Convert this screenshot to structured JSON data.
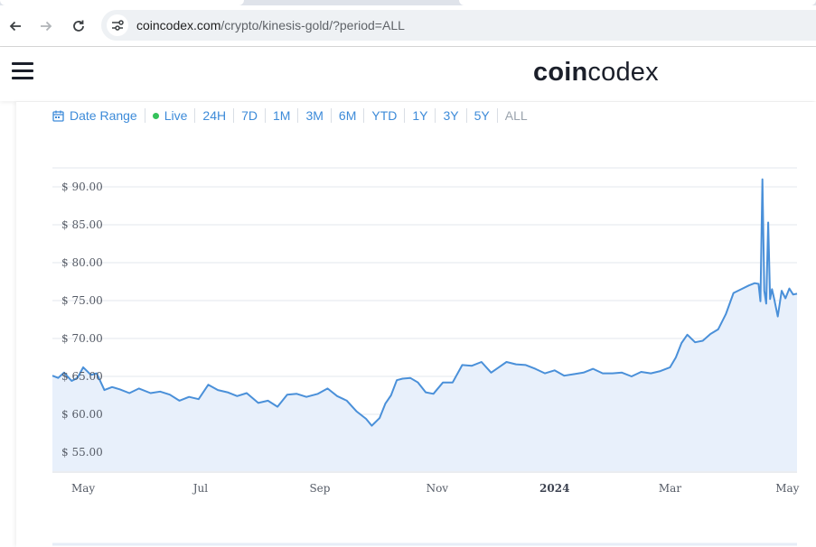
{
  "browser": {
    "url_host": "coincodex.com",
    "url_path": "/crypto/kinesis-gold/?period=ALL"
  },
  "site": {
    "logo_bold": "coin",
    "logo_light": "codex"
  },
  "periods": {
    "date_range": "Date Range",
    "live": "Live",
    "items": [
      "24H",
      "7D",
      "1M",
      "3M",
      "6M",
      "YTD",
      "1Y",
      "3Y",
      "5Y",
      "ALL"
    ],
    "selected": "ALL"
  },
  "colors": {
    "line": "#4a90d9",
    "area": "#e8f0fb",
    "accent": "#3d8bd9",
    "live_dot": "#35c25b"
  },
  "chart_data": {
    "type": "area",
    "title": "",
    "xlabel": "",
    "ylabel": "",
    "ylim": [
      52.5,
      92.5
    ],
    "grid": true,
    "y_ticks": [
      "$ 55.00",
      "$ 60.00",
      "$ 65.00",
      "$ 70.00",
      "$ 75.00",
      "$ 80.00",
      "$ 85.00",
      "$ 90.00"
    ],
    "y_tick_values": [
      55,
      60,
      65,
      70,
      75,
      80,
      85,
      90
    ],
    "x_ticks": [
      "May",
      "Jul",
      "Sep",
      "Nov",
      "2024",
      "Mar",
      "May"
    ],
    "x_tick_dates": [
      "2023-05-01",
      "2023-07-01",
      "2023-09-01",
      "2023-11-01",
      "2024-01-01",
      "2024-03-01",
      "2024-05-01"
    ],
    "x_range": [
      "2023-04-15",
      "2024-05-06"
    ],
    "series": [
      {
        "x": [
          "2023-04-15",
          "2023-04-18",
          "2023-04-21",
          "2023-04-25",
          "2023-04-28",
          "2023-05-01",
          "2023-05-05",
          "2023-05-08",
          "2023-05-12",
          "2023-05-16",
          "2023-05-20",
          "2023-05-25",
          "2023-05-30",
          "2023-06-05",
          "2023-06-10",
          "2023-06-15",
          "2023-06-20",
          "2023-06-25",
          "2023-06-30",
          "2023-07-05",
          "2023-07-10",
          "2023-07-15",
          "2023-07-20",
          "2023-07-25",
          "2023-07-31",
          "2023-08-05",
          "2023-08-10",
          "2023-08-15",
          "2023-08-20",
          "2023-08-25",
          "2023-08-31",
          "2023-09-05",
          "2023-09-10",
          "2023-09-15",
          "2023-09-20",
          "2023-09-25",
          "2023-09-28",
          "2023-10-02",
          "2023-10-05",
          "2023-10-08",
          "2023-10-11",
          "2023-10-14",
          "2023-10-18",
          "2023-10-22",
          "2023-10-26",
          "2023-10-30",
          "2023-11-04",
          "2023-11-09",
          "2023-11-14",
          "2023-11-19",
          "2023-11-24",
          "2023-11-29",
          "2023-12-03",
          "2023-12-07",
          "2023-12-12",
          "2023-12-17",
          "2023-12-22",
          "2023-12-27",
          "2024-01-01",
          "2024-01-06",
          "2024-01-11",
          "2024-01-16",
          "2024-01-21",
          "2024-01-26",
          "2024-01-31",
          "2024-02-05",
          "2024-02-10",
          "2024-02-15",
          "2024-02-20",
          "2024-02-25",
          "2024-03-01",
          "2024-03-04",
          "2024-03-07",
          "2024-03-10",
          "2024-03-14",
          "2024-03-18",
          "2024-03-22",
          "2024-03-26",
          "2024-03-30",
          "2024-04-03",
          "2024-04-07",
          "2024-04-11",
          "2024-04-14",
          "2024-04-16",
          "2024-04-17",
          "2024-04-18",
          "2024-04-19",
          "2024-04-20",
          "2024-04-21",
          "2024-04-22",
          "2024-04-23",
          "2024-04-24",
          "2024-04-26",
          "2024-04-28",
          "2024-04-30",
          "2024-05-02",
          "2024-05-04",
          "2024-05-06"
        ],
        "values": [
          65.1,
          64.8,
          65.5,
          64.4,
          64.8,
          66.2,
          65.2,
          65.4,
          63.2,
          63.6,
          63.3,
          62.8,
          63.4,
          62.8,
          63.0,
          62.6,
          61.8,
          62.3,
          62.0,
          63.9,
          63.2,
          62.9,
          62.4,
          62.8,
          61.5,
          61.8,
          61.0,
          62.6,
          62.7,
          62.3,
          62.7,
          63.4,
          62.4,
          61.8,
          60.4,
          59.4,
          58.5,
          59.5,
          61.4,
          62.5,
          64.5,
          64.7,
          64.8,
          64.2,
          62.9,
          62.7,
          64.2,
          64.2,
          66.5,
          66.4,
          66.9,
          65.5,
          66.2,
          66.9,
          66.6,
          66.5,
          66.0,
          65.4,
          65.8,
          65.1,
          65.3,
          65.5,
          66.0,
          65.4,
          65.4,
          65.5,
          65.0,
          65.6,
          65.4,
          65.7,
          66.2,
          67.5,
          69.4,
          70.5,
          69.5,
          69.7,
          70.6,
          71.2,
          73.2,
          76.0,
          76.5,
          77.0,
          77.3,
          77.2,
          74.9,
          91.0,
          76.3,
          74.6,
          85.3,
          75.2,
          76.5,
          75.4,
          72.9,
          76.3,
          75.3,
          76.6,
          75.8,
          75.9
        ]
      }
    ]
  }
}
